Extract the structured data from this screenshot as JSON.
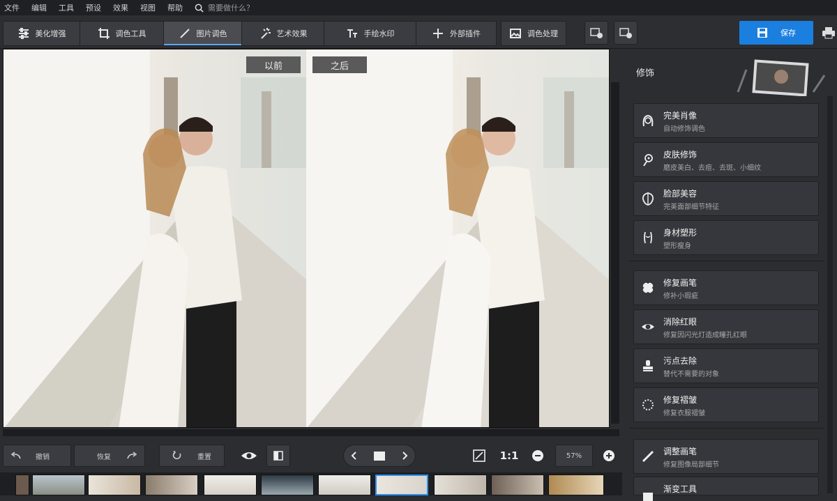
{
  "menu": [
    "文件",
    "编辑",
    "工具",
    "预设",
    "效果",
    "视图",
    "帮助"
  ],
  "search_placeholder": "需要做什么？",
  "tabs": [
    "美化增强",
    "调色工具",
    "图片调色",
    "艺术效果",
    "手绘水印",
    "外部插件",
    "调色处理"
  ],
  "active_tab": 2,
  "save_label": "保存",
  "compare": {
    "before": "以前",
    "after": "之后"
  },
  "panel": {
    "title": "修饰",
    "items": [
      {
        "title": "完美肖像",
        "desc": "自动修饰调色",
        "icon": "face-icon"
      },
      {
        "title": "皮肤修饰",
        "desc": "磨皮美白、去痘、去斑、小细纹",
        "icon": "skin-icon"
      },
      {
        "title": "脸部美容",
        "desc": "完美面部细节特征",
        "icon": "face-shape-icon"
      },
      {
        "title": "身材塑形",
        "desc": "塑形瘦身",
        "icon": "body-icon"
      },
      {
        "title": "修复画笔",
        "desc": "修补小瑕疵",
        "icon": "bandage-icon"
      },
      {
        "title": "消除红眼",
        "desc": "修复因闪光灯造成瞳孔红眼",
        "icon": "eye-icon"
      },
      {
        "title": "污点去除",
        "desc": "替代不需要的对象",
        "icon": "stamp-icon"
      },
      {
        "title": "修复褶皱",
        "desc": "修复衣服褶皱",
        "icon": "wrinkle-icon"
      },
      {
        "title": "调整画笔",
        "desc": "修复图像局部细节",
        "icon": "brush-icon"
      },
      {
        "title": "渐变工具",
        "desc": "",
        "icon": "gradient-icon"
      }
    ]
  },
  "bottom": {
    "undo": "撤销",
    "redo": "恢复",
    "reset": "重置",
    "zoom_label": "1:1",
    "zoom_value": "57%"
  },
  "colors": {
    "accent": "#1b7fe0",
    "panel": "#2b2d31",
    "item": "#35373c"
  }
}
